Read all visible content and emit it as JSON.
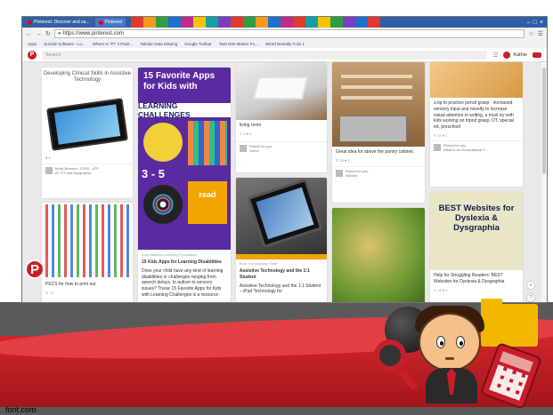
{
  "browser": {
    "tabs": [
      {
        "label": "Pinterest: Discover and sa...",
        "active": false
      },
      {
        "label": "Pinterest",
        "active": true
      }
    ],
    "url": "https://www.pinterest.com",
    "url_secure_prefix": "https://",
    "bookmarks": [
      "Apps",
      "Suicide Software - Lo...",
      "Where Is \"Pi\" 2 Paint...",
      "Tabular Data Missing",
      "Google Toolbar",
      "Twin Rite Marker Po...",
      "Wired Dentally Folio 1"
    ]
  },
  "pinterest": {
    "search_placeholder": "Search",
    "user_name": "Kathie",
    "pins": {
      "p1": {
        "image_text": "Developing Clinical Skills in Assistive Technology",
        "stat": "♥ 5",
        "via_name": "Molly Brannon, OTR/L, ATP",
        "via_board": "AT OT and Dysgraphia"
      },
      "p2": {
        "image_title": "15 Favorite Apps for Kids with",
        "image_banner": "LEARNING CHALLENGES",
        "image_number": "3 - 5",
        "image_tag": "read",
        "source": "from Bamboo Learning Foundation",
        "title": "15 Kids Apps for Learning Disabilities",
        "desc": "Does your child have any kind of learning disabilities or challenges ranging from speech delays, to autism to sensory issues? These 15 Favorite Apps for Kids with Learning Challenges is a resource"
      },
      "p3": {
        "caption": "living room",
        "stat": "↻ 8  ♥ 4",
        "via_name": "Picked for you",
        "via_board": "Home"
      },
      "p4": {
        "caption": "Great idea for above the pantry cabinet.",
        "stat": "↻ 39  ♥ 1",
        "via_name": "Picked for you",
        "via_board": "Kitchen"
      },
      "p5": {
        "caption": "a tip to practice pencil grasp - increased sensory input and novelty to increase visual attention to writing, a must try with kids working on tripod grasp, OT, special ed, preschool",
        "stat": "↻ 11  ♥ 1",
        "via_name": "Picked for you",
        "via_board": "What is an Occupational T..."
      },
      "p6": {
        "caption": "PECS for how to print out",
        "stat": "↻ 73"
      },
      "p7": {
        "source": "from The Assistive Tech",
        "title": "Assistive Technology and the 1:1 Student",
        "desc": "Assistive Technology and the 1:1 Student – iPad Technology for"
      },
      "p8": {},
      "p9": {
        "image_text": "BEST Websites for Dyslexia & Dysgraphia",
        "caption": "Help for Struggling Readers: BEST Websites for Dyslexia & Dysgraphia",
        "stat": "↻ 22  ♥ 1"
      }
    }
  },
  "slide": {
    "footer": "font.com"
  },
  "colors": {
    "pinterest_red": "#cb2027",
    "slide_red": "#c81e2a",
    "browser_blue": "#2e5fa8"
  },
  "icons": [
    "back-icon",
    "forward-icon",
    "reload-icon",
    "lock-icon",
    "star-icon",
    "menu-icon",
    "pinterest-logo-icon",
    "notifications-icon",
    "plus-icon",
    "help-icon",
    "globe-icon",
    "folder-icon",
    "magnifier-icon",
    "calculator-icon"
  ]
}
